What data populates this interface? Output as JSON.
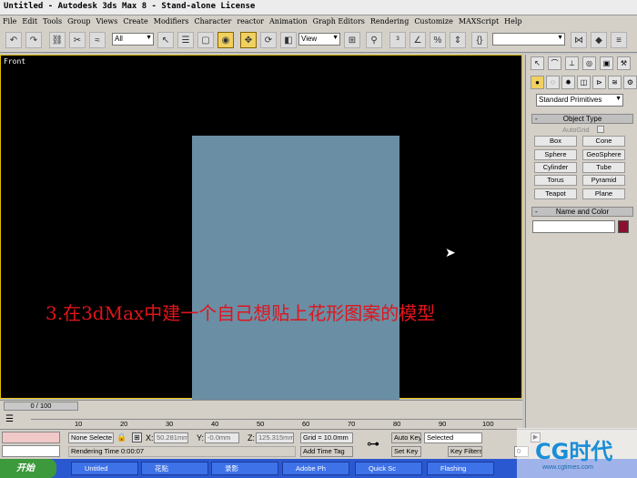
{
  "window": {
    "title": "Untitled - Autodesk 3ds Max 8  - Stand-alone License"
  },
  "menu": [
    "File",
    "Edit",
    "Tools",
    "Group",
    "Views",
    "Create",
    "Modifiers",
    "Character",
    "reactor",
    "Animation",
    "Graph Editors",
    "Rendering",
    "Customize",
    "MAXScript",
    "Help"
  ],
  "toolbar": {
    "filter_value": "All",
    "refcoord_value": "View"
  },
  "viewport": {
    "label": "Front",
    "caption": "3.在3dMax中建一个自己想贴上花形图案的模型",
    "plane_color": "#6a8ea4"
  },
  "command_panel": {
    "category_value": "Standard Primitives",
    "object_type_header": "Object Type",
    "autogrid_label": "AutoGrid",
    "primitives": [
      "Box",
      "Cone",
      "Sphere",
      "GeoSphere",
      "Cylinder",
      "Tube",
      "Torus",
      "Pyramid",
      "Teapot",
      "Plane"
    ],
    "name_color_header": "Name and Color",
    "object_color": "#8b1030"
  },
  "timeline": {
    "frame_display": "0 / 100",
    "ticks": [
      "10",
      "20",
      "30",
      "40",
      "50",
      "60",
      "70",
      "80",
      "90",
      "100"
    ]
  },
  "status": {
    "selection": "None Selecte",
    "x_label": "X:",
    "x_value": "50.281mm",
    "y_label": "Y:",
    "y_value": "-0.0mm",
    "z_label": "Z:",
    "z_value": "125.315mm",
    "grid": "Grid = 10.0mm",
    "render_time": "Rendering Time  0:00:07",
    "add_time_tag": "Add Time Tag",
    "auto_key": "Auto Key",
    "set_key": "Set Key",
    "key_mode": "Selected",
    "key_filters": "Key Filters...",
    "frame": "0"
  },
  "taskbar": {
    "start": "开始",
    "tasks": [
      "Untitled",
      "花贴",
      "录影",
      "Adobe Ph",
      "Quick Sc",
      "Flashing"
    ]
  },
  "watermark": {
    "logo": "CG时代",
    "url": "www.cgtimes.com"
  }
}
